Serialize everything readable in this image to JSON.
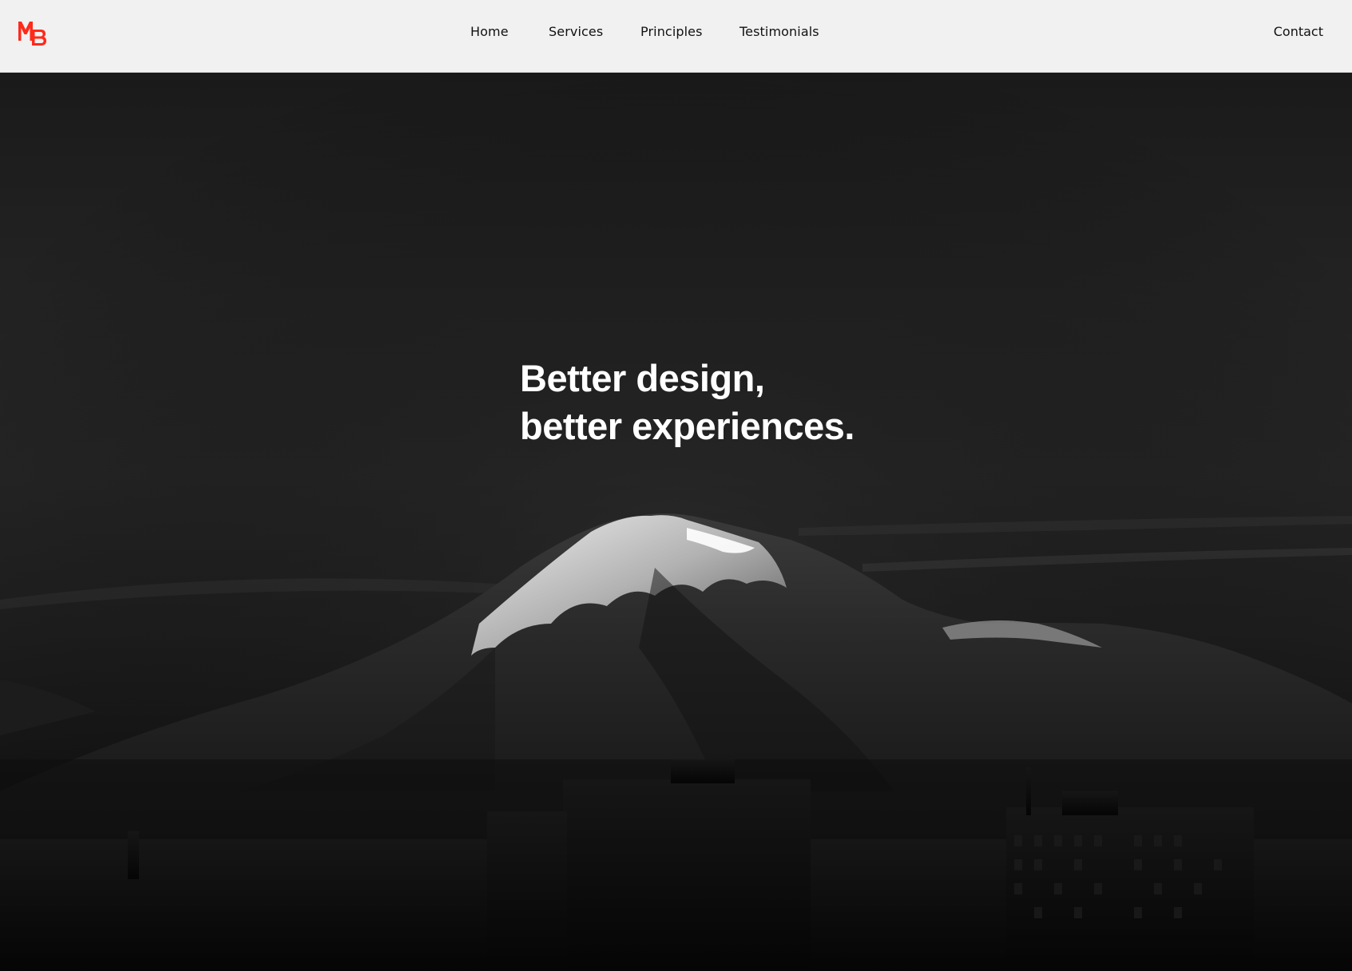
{
  "brand": {
    "logo_text": "MB",
    "logo_color": "#ff2a1a"
  },
  "nav": {
    "items": [
      "Home",
      "Services",
      "Principles",
      "Testimonials"
    ],
    "contact": "Contact"
  },
  "hero": {
    "headline_line1": "Better design,",
    "headline_line2": "better experiences.",
    "image_subject": "mountain-landscape"
  },
  "colors": {
    "header_bg": "#f0f1f0",
    "hero_text": "#ffffff"
  }
}
